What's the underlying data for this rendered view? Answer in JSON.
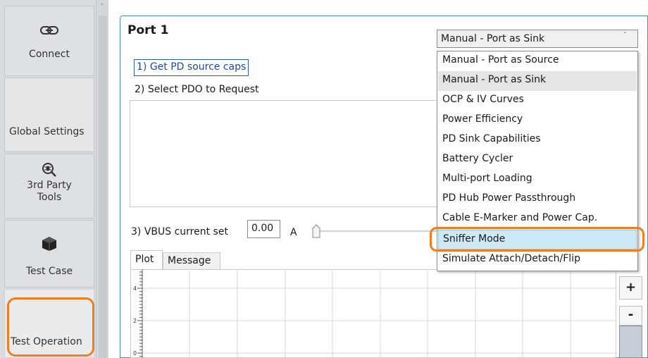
{
  "sidebar": {
    "items": [
      {
        "label": "Connect",
        "icon": "link-icon"
      },
      {
        "label": "Global Settings",
        "icon": ""
      },
      {
        "label": "3rd Party Tools",
        "line1": "3rd Party",
        "line2": "Tools",
        "icon": "bug-search-icon"
      },
      {
        "label": "Test Case",
        "icon": "cube-icon"
      },
      {
        "label": "Test Operation",
        "icon": ""
      }
    ],
    "highlight_color": "#f07d1e"
  },
  "panel": {
    "title": "Port 1",
    "get_caps_button": "1) Get PD source caps",
    "select_pdo_label": "2) Select PDO to Request",
    "vbus_label": "3) VBUS current set",
    "vbus_value": "0.00",
    "vbus_unit": "A",
    "slider_level": 0
  },
  "tabs": [
    {
      "label": "Plot",
      "active": true
    },
    {
      "label": "Message",
      "active": false
    }
  ],
  "plot": {
    "y_ticks": [
      "4",
      "2",
      "0"
    ]
  },
  "zoom": {
    "plus_label": "+",
    "minus_label": "-"
  },
  "mode_select": {
    "selected": "Manual - Port as Sink",
    "options": [
      "Manual - Port as Source",
      "Manual - Port as Sink",
      "OCP & IV Curves",
      "Power Efficiency",
      "PD Sink Capabilities",
      "Battery Cycler",
      "Multi-port Loading",
      "PD Hub Power Passthrough",
      "Cable E-Marker and Power Cap.",
      "Sniffer Mode",
      "Simulate Attach/Detach/Flip"
    ],
    "hovered_option": "Manual - Port as Sink",
    "highlighted_option": "Sniffer Mode"
  },
  "colors": {
    "accent_border": "#4a8ad4",
    "highlight": "#f07d1e",
    "selected_option_bg": "#cde8f6"
  }
}
